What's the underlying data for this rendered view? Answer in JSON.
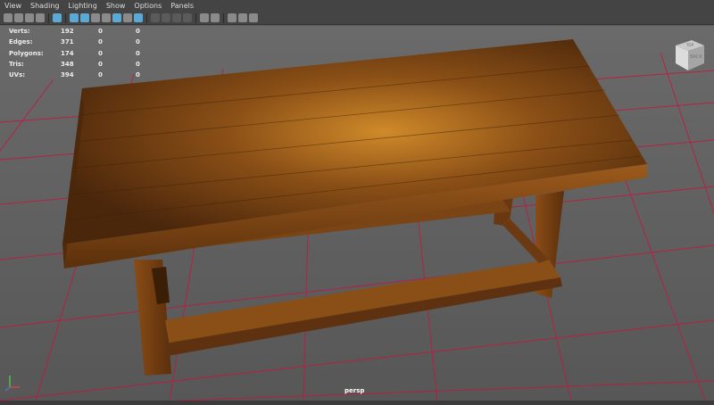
{
  "menu": [
    "View",
    "Shading",
    "Lighting",
    "Show",
    "Options",
    "Panels"
  ],
  "hud": [
    {
      "label": "Verts:",
      "v1": "192",
      "v2": "0",
      "v3": "0"
    },
    {
      "label": "Edges:",
      "v1": "371",
      "v2": "0",
      "v3": "0"
    },
    {
      "label": "Polygons:",
      "v1": "174",
      "v2": "0",
      "v3": "0"
    },
    {
      "label": "Tris:",
      "v1": "348",
      "v2": "0",
      "v3": "0"
    },
    {
      "label": "UVs:",
      "v1": "394",
      "v2": "0",
      "v3": "0"
    }
  ],
  "viewcube": {
    "top": "TOP",
    "front": "BACK"
  },
  "camera": "persp",
  "colors": {
    "grid": "#c4173f",
    "wood": "#7a4414",
    "accent": "#5aa9d6"
  }
}
